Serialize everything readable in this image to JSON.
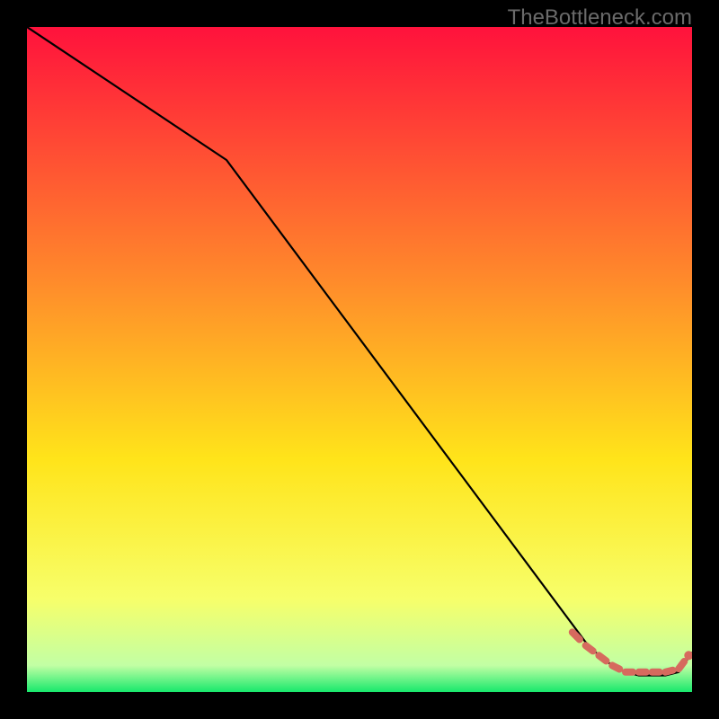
{
  "watermark": "TheBottleneck.com",
  "colors": {
    "gradient_top": "#ff123c",
    "gradient_mid1": "#ff8a2b",
    "gradient_mid2": "#ffe41a",
    "gradient_mid3": "#f7ff6a",
    "gradient_bottom": "#17e86c",
    "line": "#000000",
    "dots": "#d66a5e",
    "bg": "#000000"
  },
  "chart_data": {
    "type": "line",
    "title": "",
    "xlabel": "",
    "ylabel": "",
    "xlim": [
      0,
      100
    ],
    "ylim": [
      0,
      100
    ],
    "series": [
      {
        "name": "curve",
        "x": [
          0,
          30,
          84,
          86,
          88,
          90,
          92,
          94,
          96,
          98,
          100
        ],
        "values": [
          100,
          80,
          7.5,
          5.5,
          4,
          3,
          2.5,
          2.5,
          2.5,
          3,
          6
        ]
      }
    ],
    "dotted_segment": {
      "x": [
        82,
        84,
        86,
        88,
        90,
        92,
        94,
        96,
        98,
        99.5
      ],
      "values": [
        9,
        7,
        5.5,
        4,
        3,
        3,
        3,
        3,
        3.5,
        5.5
      ]
    }
  }
}
